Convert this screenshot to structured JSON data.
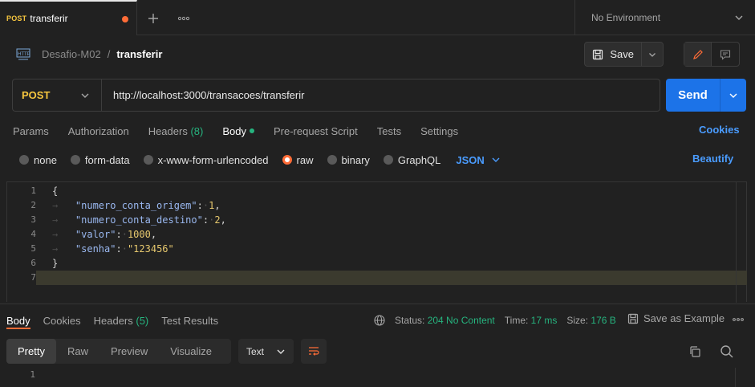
{
  "tabbar": {
    "request_tab": {
      "method": "POST",
      "name": "transferir"
    },
    "environment": "No Environment"
  },
  "breadcrumb": {
    "collection": "Desafio-M02",
    "separator": "/",
    "request": "transferir"
  },
  "toolbar": {
    "save_label": "Save"
  },
  "urlbar": {
    "method": "POST",
    "url": "http://localhost:3000/transacoes/transferir",
    "send_label": "Send"
  },
  "request_tabs": {
    "params": "Params",
    "authorization": "Authorization",
    "headers": "Headers",
    "headers_count": "(8)",
    "body": "Body",
    "pre_request": "Pre-request Script",
    "tests": "Tests",
    "settings": "Settings",
    "cookies": "Cookies"
  },
  "body_types": {
    "none": "none",
    "form_data": "form-data",
    "urlencoded": "x-www-form-urlencoded",
    "raw": "raw",
    "binary": "binary",
    "graphql": "GraphQL",
    "format": "JSON",
    "beautify": "Beautify",
    "selected": "raw"
  },
  "editor": {
    "line_numbers": [
      "1",
      "2",
      "3",
      "4",
      "5",
      "6",
      "7"
    ],
    "open_brace": "{",
    "close_brace": "}",
    "fields": [
      {
        "key": "\"numero_conta_origem\"",
        "colon": ":",
        "value": "1",
        "comma": ","
      },
      {
        "key": "\"numero_conta_destino\"",
        "colon": ":",
        "value": "2",
        "comma": ","
      },
      {
        "key": "\"valor\"",
        "colon": ":",
        "value": "1000",
        "comma": ","
      },
      {
        "key": "\"senha\"",
        "colon": ":",
        "value": "\"123456\"",
        "comma": ""
      }
    ]
  },
  "response": {
    "tabs": {
      "body": "Body",
      "cookies": "Cookies",
      "headers": "Headers",
      "headers_count": "(5)",
      "test_results": "Test Results"
    },
    "status_label": "Status:",
    "status_value": "204 No Content",
    "time_label": "Time:",
    "time_value": "17 ms",
    "size_label": "Size:",
    "size_value": "176 B",
    "save_as_example": "Save as Example",
    "view_modes": [
      "Pretty",
      "Raw",
      "Preview",
      "Visualize"
    ],
    "format": "Text",
    "line_numbers": [
      "1"
    ]
  },
  "colors": {
    "accent_orange": "#ff6c37",
    "send_blue": "#1c73e8",
    "link_blue": "#4a9cff",
    "success_green": "#26b47f",
    "method_yellow": "#f6c63f"
  }
}
